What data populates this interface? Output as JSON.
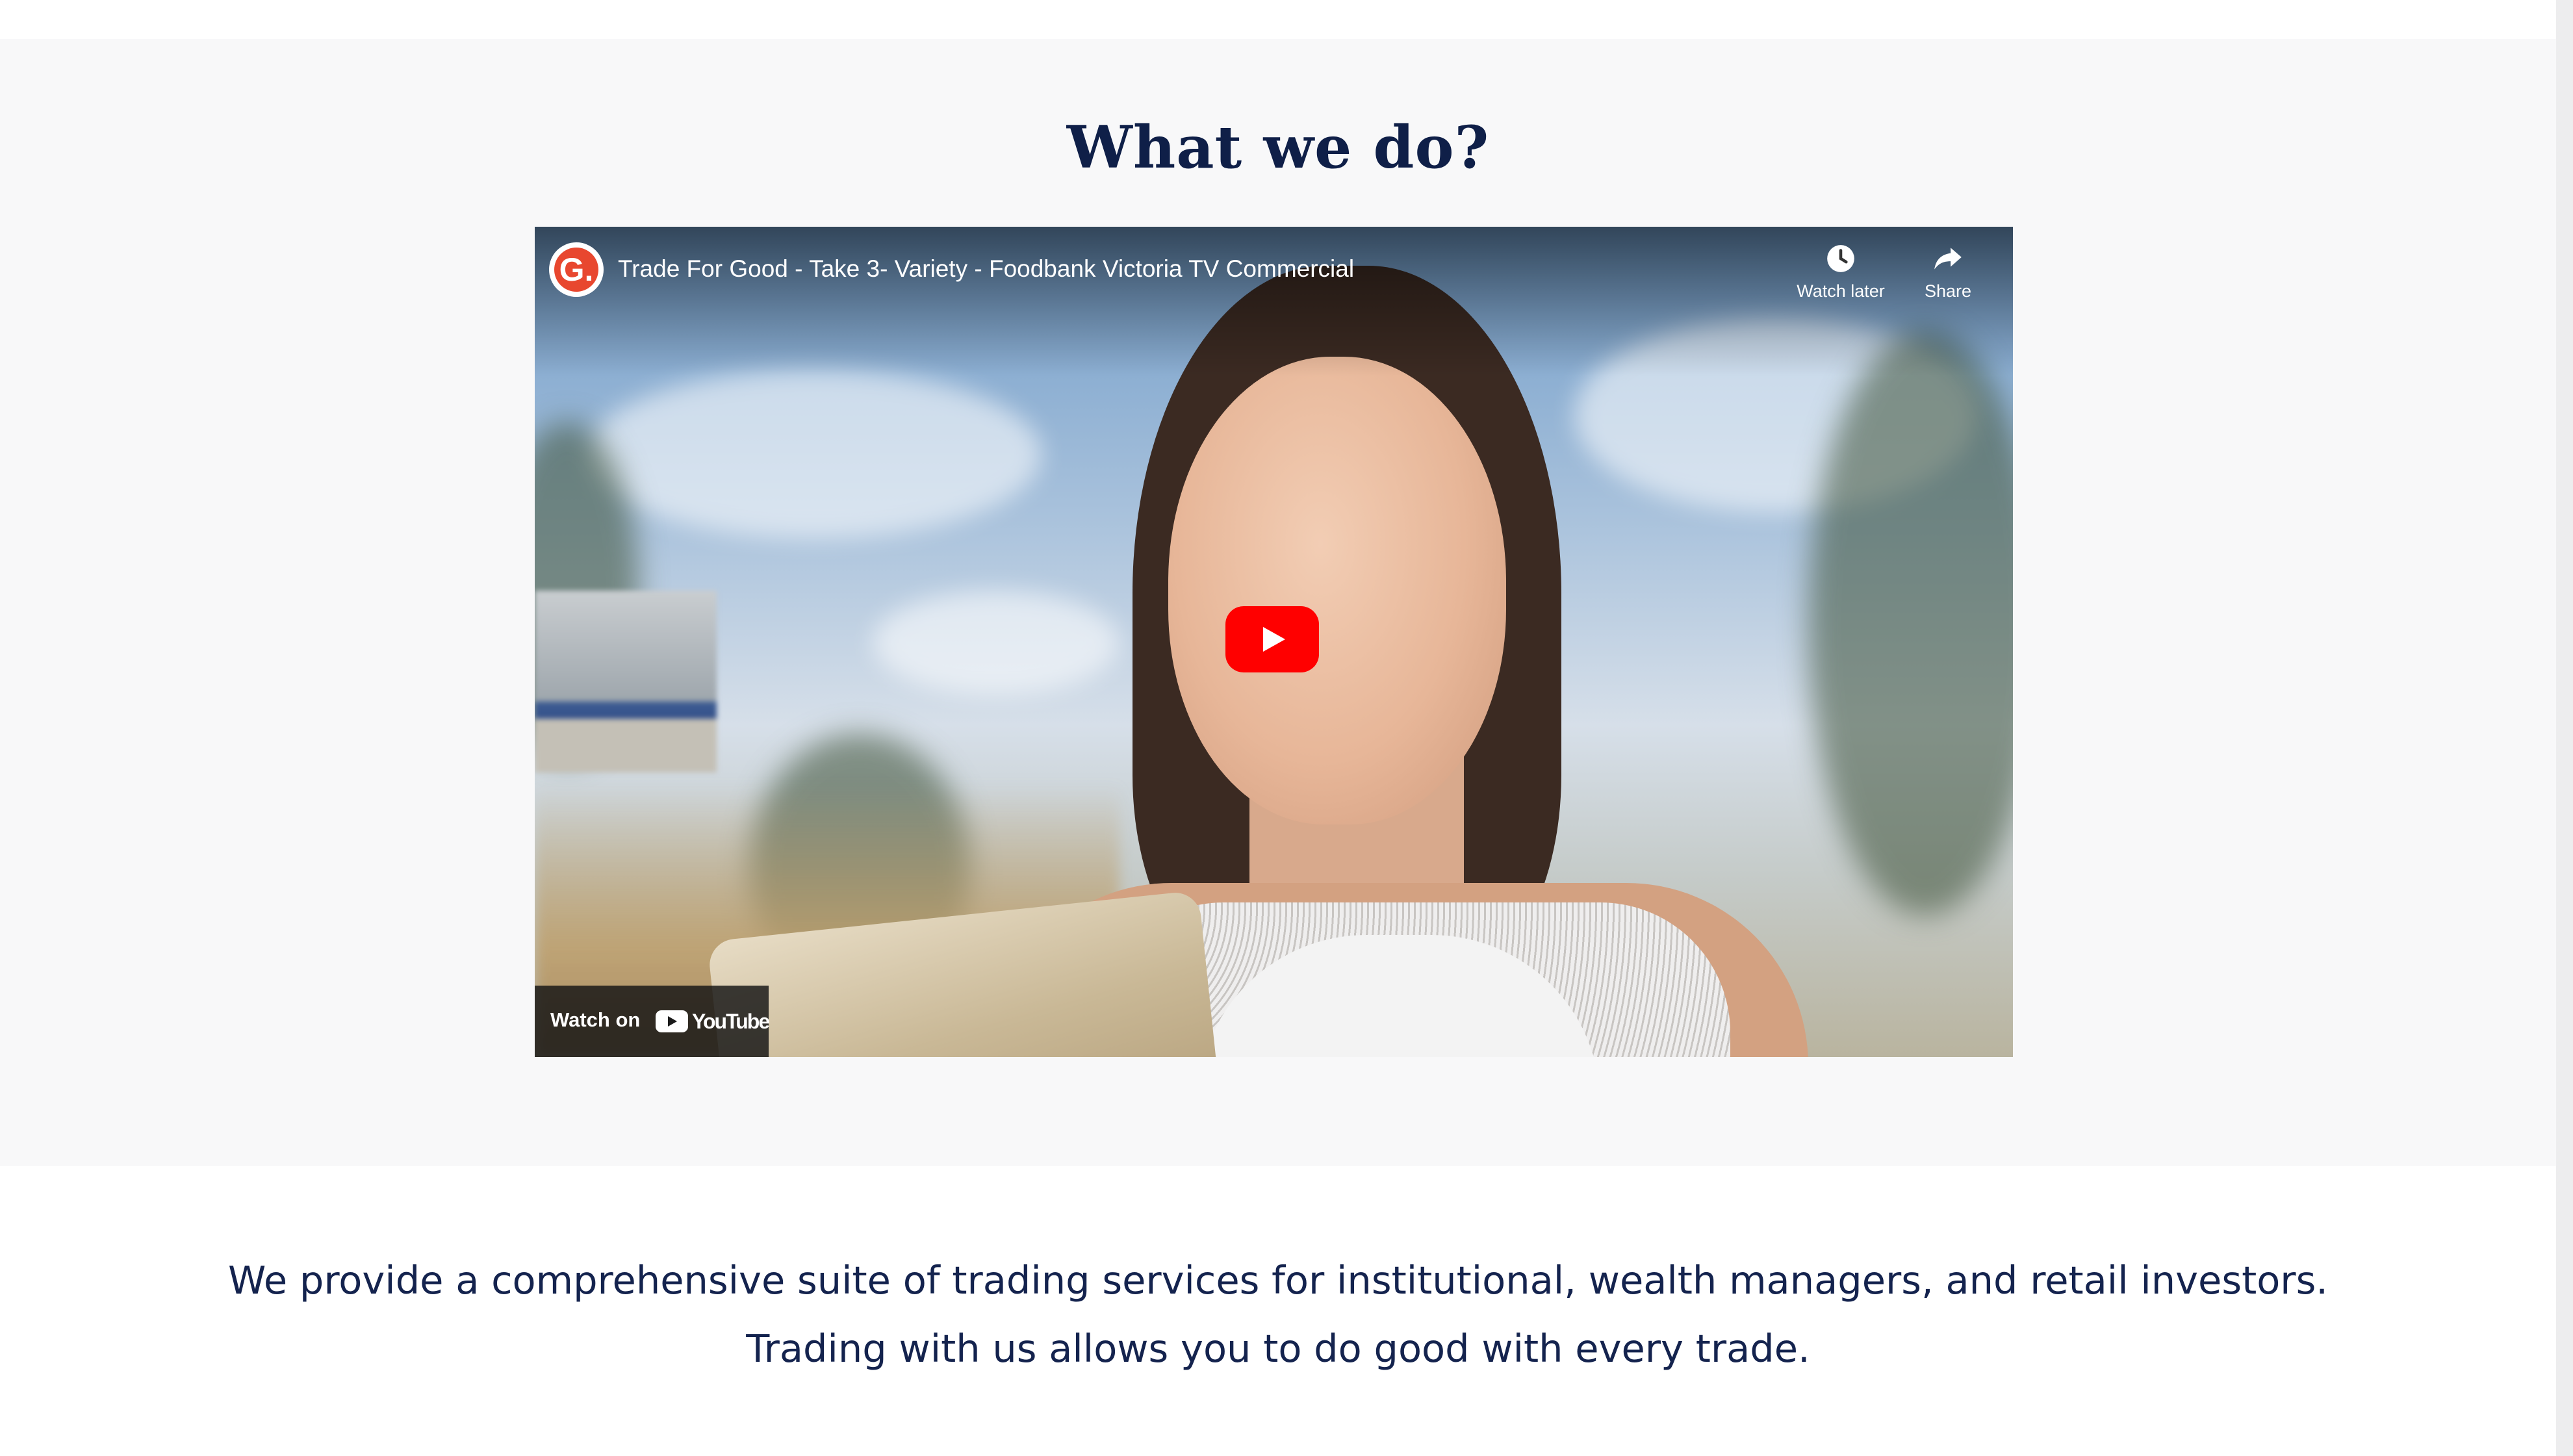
{
  "section": {
    "heading": "What we do?"
  },
  "video": {
    "channel_logo_letter": "G.",
    "title": "Trade For Good - Take 3- Variety - Foodbank Victoria TV Commercial",
    "watch_later_label": "Watch later",
    "share_label": "Share",
    "watch_on_label": "Watch on",
    "youtube_brand": "YouTube",
    "play_button_color": "#ff0000"
  },
  "description": {
    "line1": "We provide a comprehensive suite of trading services for institutional, wealth managers, and retail investors.",
    "line2": "Trading with us allows you to do good with every trade."
  },
  "colors": {
    "heading": "#0f1f48",
    "body_text": "#14234e",
    "section_background": "#f8f8f9"
  },
  "icons": {
    "watch_later": "clock-icon",
    "share": "share-arrow-icon",
    "play": "play-icon"
  }
}
